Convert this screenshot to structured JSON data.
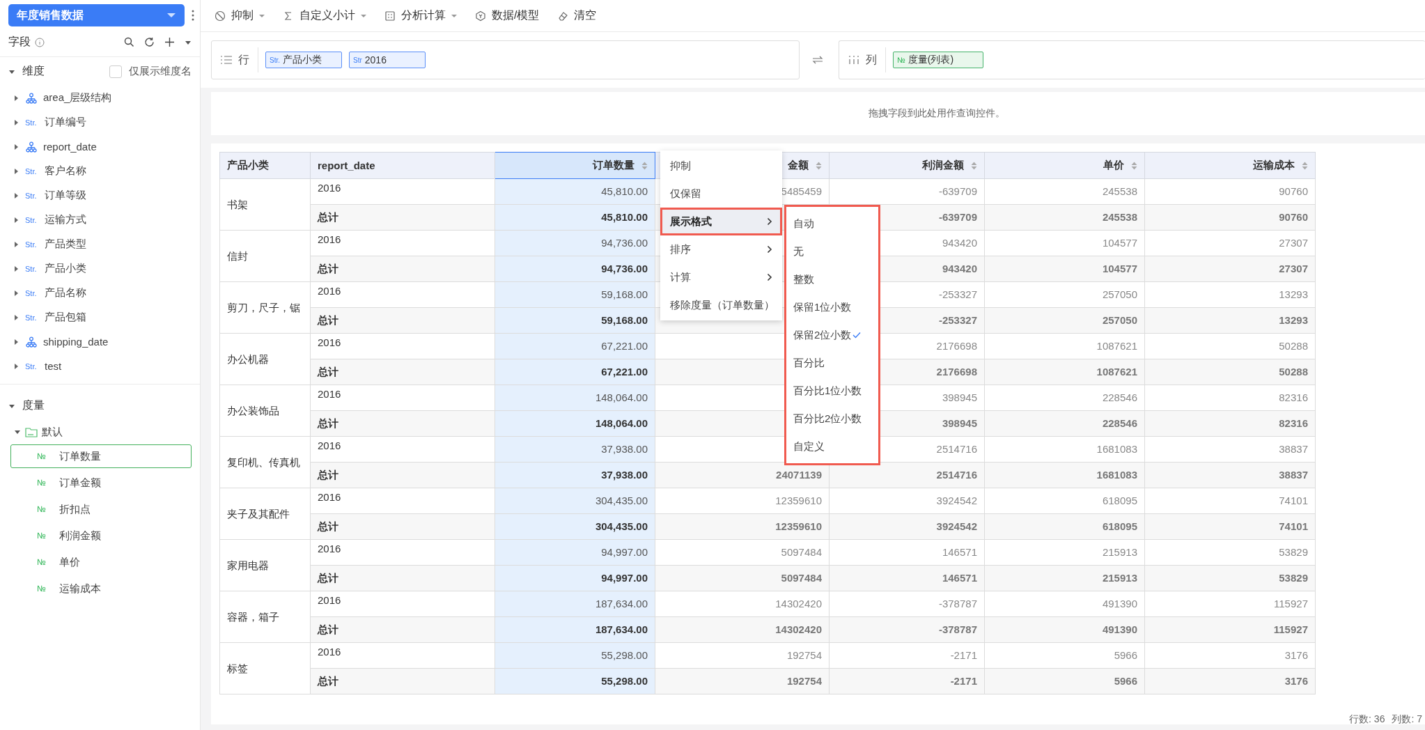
{
  "sidebar": {
    "dataset": "年度销售数据",
    "fields_title": "字段",
    "dimensions": {
      "title": "维度",
      "expanded": true,
      "show_names_only": {
        "label": "仅展示维度名",
        "checked": false
      },
      "items": [
        {
          "kind": "hierarchy",
          "name": "area_层级结构",
          "expanded": false
        },
        {
          "kind": "string",
          "type_label": "Str.",
          "name": "订单编号",
          "expanded": false
        },
        {
          "kind": "hierarchy",
          "name": "report_date",
          "expanded": false
        },
        {
          "kind": "string",
          "type_label": "Str.",
          "name": "客户名称",
          "expanded": false
        },
        {
          "kind": "string",
          "type_label": "Str.",
          "name": "订单等级",
          "expanded": false
        },
        {
          "kind": "string",
          "type_label": "Str.",
          "name": "运输方式",
          "expanded": false
        },
        {
          "kind": "string",
          "type_label": "Str.",
          "name": "产品类型",
          "expanded": false
        },
        {
          "kind": "string",
          "type_label": "Str.",
          "name": "产品小类",
          "expanded": false
        },
        {
          "kind": "string",
          "type_label": "Str.",
          "name": "产品名称",
          "expanded": false
        },
        {
          "kind": "string",
          "type_label": "Str.",
          "name": "产品包箱",
          "expanded": false
        },
        {
          "kind": "hierarchy",
          "name": "shipping_date",
          "expanded": false
        },
        {
          "kind": "string",
          "type_label": "Str.",
          "name": "test",
          "expanded": false
        }
      ]
    },
    "measures": {
      "title": "度量",
      "expanded": true,
      "folders": [
        {
          "name": "默认",
          "expanded": true,
          "items": [
            {
              "type_label": "№",
              "name": "订单数量",
              "selected": true
            },
            {
              "type_label": "№",
              "name": "订单金额",
              "selected": false
            },
            {
              "type_label": "№",
              "name": "折扣点",
              "selected": false
            },
            {
              "type_label": "№",
              "name": "利润金额",
              "selected": false
            },
            {
              "type_label": "№",
              "name": "单价",
              "selected": false
            },
            {
              "type_label": "№",
              "name": "运输成本",
              "selected": false
            }
          ]
        }
      ]
    }
  },
  "toolbar": [
    {
      "label": "抑制",
      "dropdown": true
    },
    {
      "label": "自定义小计",
      "dropdown": true
    },
    {
      "label": "分析计算",
      "dropdown": true
    },
    {
      "label": "数据/模型",
      "dropdown": false
    },
    {
      "label": "清空",
      "dropdown": false
    }
  ],
  "shelves": {
    "rows": {
      "label": "行",
      "chips": [
        {
          "type_label": "Str.",
          "label": "产品小类"
        },
        {
          "type_label": "Str",
          "label": "2016"
        }
      ]
    },
    "columns": {
      "label": "列",
      "chips": [
        {
          "type_label": "№",
          "label": "度量(列表)"
        }
      ]
    }
  },
  "filter_area": {
    "hint": "拖拽字段到此处用作查询控件。"
  },
  "table": {
    "columns": [
      {
        "label": "产品小类",
        "selected": false
      },
      {
        "label": "report_date",
        "selected": false
      },
      {
        "label": "订单数量",
        "selected": true
      },
      {
        "label": "金额",
        "selected": false
      },
      {
        "label": "利润金额",
        "selected": false
      },
      {
        "label": "单价",
        "selected": false
      },
      {
        "label": "运输成本",
        "selected": false
      }
    ],
    "groups": [
      {
        "category": "书架",
        "rows": [
          {
            "kind": "detail",
            "date": "2016",
            "quantity": "45,810.00",
            "amount": "5485459",
            "profit": "-639709",
            "unit_price": "245538",
            "shipping_cost": "90760"
          },
          {
            "kind": "total",
            "date": "总计",
            "quantity": "45,810.00",
            "profit": "-639709",
            "unit_price": "245538",
            "shipping_cost": "90760"
          }
        ]
      },
      {
        "category": "信封",
        "rows": [
          {
            "kind": "detail",
            "date": "2016",
            "quantity": "94,736.00",
            "profit": "943420",
            "unit_price": "104577",
            "shipping_cost": "27307"
          },
          {
            "kind": "total",
            "date": "总计",
            "quantity": "94,736.00",
            "profit": "943420",
            "unit_price": "104577",
            "shipping_cost": "27307"
          }
        ]
      },
      {
        "category": "剪刀，尺子，锯",
        "rows": [
          {
            "kind": "detail",
            "date": "2016",
            "quantity": "59,168.00",
            "profit": "-253327",
            "unit_price": "257050",
            "shipping_cost": "13293"
          },
          {
            "kind": "total",
            "date": "总计",
            "quantity": "59,168.00",
            "profit": "-253327",
            "unit_price": "257050",
            "shipping_cost": "13293"
          }
        ]
      },
      {
        "category": "办公机器",
        "rows": [
          {
            "kind": "detail",
            "date": "2016",
            "quantity": "67,221.00",
            "profit": "2176698",
            "unit_price": "1087621",
            "shipping_cost": "50288"
          },
          {
            "kind": "total",
            "date": "总计",
            "quantity": "67,221.00",
            "profit": "2176698",
            "unit_price": "1087621",
            "shipping_cost": "50288"
          }
        ]
      },
      {
        "category": "办公装饰品",
        "rows": [
          {
            "kind": "detail",
            "date": "2016",
            "quantity": "148,064.00",
            "profit": "398945",
            "unit_price": "228546",
            "shipping_cost": "82316"
          },
          {
            "kind": "total",
            "date": "总计",
            "quantity": "148,064.00",
            "profit": "398945",
            "unit_price": "228546",
            "shipping_cost": "82316"
          }
        ]
      },
      {
        "category": "复印机、传真机",
        "rows": [
          {
            "kind": "detail",
            "date": "2016",
            "quantity": "37,938.00",
            "profit": "2514716",
            "unit_price": "1681083",
            "shipping_cost": "38837"
          },
          {
            "kind": "total",
            "date": "总计",
            "quantity": "37,938.00",
            "amount": "24071139",
            "profit": "2514716",
            "unit_price": "1681083",
            "shipping_cost": "38837"
          }
        ]
      },
      {
        "category": "夹子及其配件",
        "rows": [
          {
            "kind": "detail",
            "date": "2016",
            "quantity": "304,435.00",
            "amount": "12359610",
            "profit": "3924542",
            "unit_price": "618095",
            "shipping_cost": "74101"
          },
          {
            "kind": "total",
            "date": "总计",
            "quantity": "304,435.00",
            "amount": "12359610",
            "profit": "3924542",
            "unit_price": "618095",
            "shipping_cost": "74101"
          }
        ]
      },
      {
        "category": "家用电器",
        "rows": [
          {
            "kind": "detail",
            "date": "2016",
            "quantity": "94,997.00",
            "amount": "5097484",
            "profit": "146571",
            "unit_price": "215913",
            "shipping_cost": "53829"
          },
          {
            "kind": "total",
            "date": "总计",
            "quantity": "94,997.00",
            "amount": "5097484",
            "profit": "146571",
            "unit_price": "215913",
            "shipping_cost": "53829"
          }
        ]
      },
      {
        "category": "容器，箱子",
        "rows": [
          {
            "kind": "detail",
            "date": "2016",
            "quantity": "187,634.00",
            "amount": "14302420",
            "profit": "-378787",
            "unit_price": "491390",
            "shipping_cost": "115927"
          },
          {
            "kind": "total",
            "date": "总计",
            "quantity": "187,634.00",
            "amount": "14302420",
            "profit": "-378787",
            "unit_price": "491390",
            "shipping_cost": "115927"
          }
        ]
      },
      {
        "category": "标签",
        "rows": [
          {
            "kind": "detail",
            "date": "2016",
            "quantity": "55,298.00",
            "amount": "192754",
            "profit": "-2171",
            "unit_price": "5966",
            "shipping_cost": "3176"
          },
          {
            "kind": "total",
            "date": "总计",
            "quantity": "55,298.00",
            "amount": "192754",
            "profit": "-2171",
            "unit_price": "5966",
            "shipping_cost": "3176"
          }
        ]
      }
    ]
  },
  "context_menu": {
    "items": [
      {
        "label": "抑制",
        "submenu": false,
        "selected": false
      },
      {
        "label": "仅保留",
        "submenu": false,
        "selected": false
      },
      {
        "label": "展示格式",
        "submenu": true,
        "selected": true
      },
      {
        "label": "排序",
        "submenu": true,
        "selected": false
      },
      {
        "label": "计算",
        "submenu": true,
        "selected": false
      },
      {
        "label": "移除度量（订单数量）",
        "submenu": false,
        "selected": false
      }
    ]
  },
  "format_submenu": {
    "items": [
      {
        "label": "自动",
        "checked": false
      },
      {
        "label": "无",
        "checked": false
      },
      {
        "label": "整数",
        "checked": false
      },
      {
        "label": "保留1位小数",
        "checked": false
      },
      {
        "label": "保留2位小数",
        "checked": true
      },
      {
        "label": "百分比",
        "checked": false
      },
      {
        "label": "百分比1位小数",
        "checked": false
      },
      {
        "label": "百分比2位小数",
        "checked": false
      },
      {
        "label": "自定义",
        "checked": false
      }
    ]
  },
  "status_bar": {
    "rows": "行数: 36",
    "columns": "列数: 7"
  }
}
